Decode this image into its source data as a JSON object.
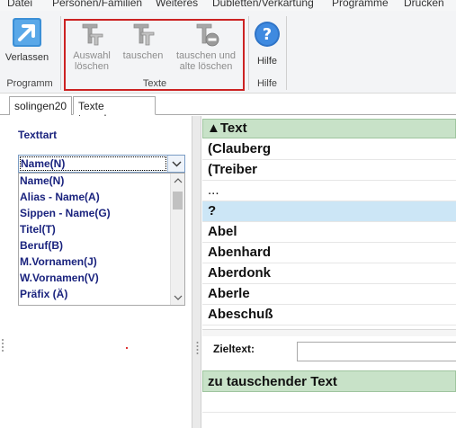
{
  "menu": {
    "items": [
      "Datei",
      "Personen/Familien",
      "Weiteres",
      "Dubletten/Verkartung",
      "Programme",
      "Drucken"
    ]
  },
  "ribbon": {
    "groups": {
      "programm": "Programm",
      "texte": "Texte",
      "hilfe": "Hilfe"
    },
    "buttons": {
      "verlassen": "Verlassen",
      "auswahl_line1": "Auswahl",
      "auswahl_line2": "löschen",
      "tauschen": "tauschen",
      "tauschen_alte_line1": "tauschen und",
      "tauschen_alte_line2": "alte löschen",
      "hilfe": "Hilfe"
    }
  },
  "tabs": [
    "solingen20",
    "Texte tauschen"
  ],
  "left": {
    "texttart_label": "Texttart",
    "selected": "Name(N)",
    "options": [
      "Name(N)",
      "Alias - Name(A)",
      "Sippen - Name(G)",
      "Titel(T)",
      "Beruf(B)",
      "M.Vornamen(J)",
      "W.Vornamen(V)",
      "Präfix (Ä)"
    ]
  },
  "grid": {
    "header": "▲Text",
    "rows": [
      "(Clauberg",
      "(Treiber",
      "...",
      "?",
      "Abel",
      "Abenhard",
      "Aberdonk",
      "Aberle",
      "Abeschuß"
    ],
    "selected_index": 3
  },
  "bottom": {
    "zieltext_label": "Zieltext:",
    "zieltext_value": "",
    "zu_tauschender_header": "zu tauschender Text"
  },
  "colors": {
    "highlight_border": "#cc2222",
    "grid_header": "#c8e2c8",
    "selected_row": "#cce6f6",
    "list_text": "#1a237e"
  }
}
